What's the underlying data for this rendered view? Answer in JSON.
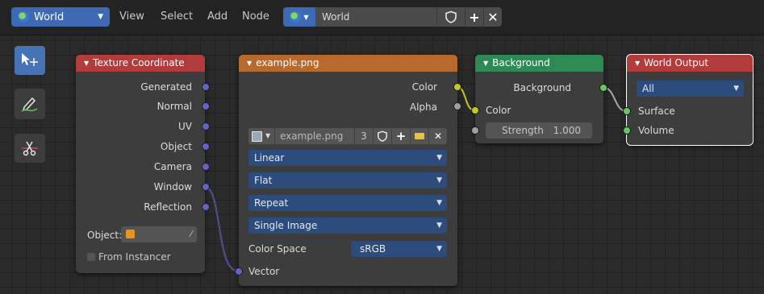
{
  "header": {
    "editor_label": "World",
    "menus": [
      "View",
      "Select",
      "Add",
      "Node"
    ],
    "world_field": "World"
  },
  "nodes": {
    "texture_coordinate": {
      "title": "Texture Coordinate",
      "outputs": [
        "Generated",
        "Normal",
        "UV",
        "Object",
        "Camera",
        "Window",
        "Reflection"
      ],
      "object_label": "Object:",
      "from_instancer": "From Instancer"
    },
    "image_texture": {
      "title": "example.png",
      "outputs": [
        "Color",
        "Alpha"
      ],
      "image_name": "example.png",
      "users": "3",
      "interpolation": "Linear",
      "projection": "Flat",
      "extension": "Repeat",
      "source": "Single Image",
      "color_space_label": "Color Space",
      "color_space": "sRGB",
      "input": "Vector"
    },
    "background": {
      "title": "Background",
      "output": "Background",
      "input_color": "Color",
      "strength_label": "Strength",
      "strength_value": "1.000"
    },
    "world_output": {
      "title": "World Output",
      "target": "All",
      "inputs": [
        "Surface",
        "Volume"
      ]
    }
  },
  "colors": {
    "header_input": "#b23b3b",
    "header_texture": "#b86a2e",
    "header_shader": "#2e8a55",
    "header_output": "#b23b3b",
    "socket_vector": "#6363c7",
    "socket_color": "#c7c729",
    "socket_float": "#a1a1a1",
    "socket_shader": "#63c763"
  }
}
